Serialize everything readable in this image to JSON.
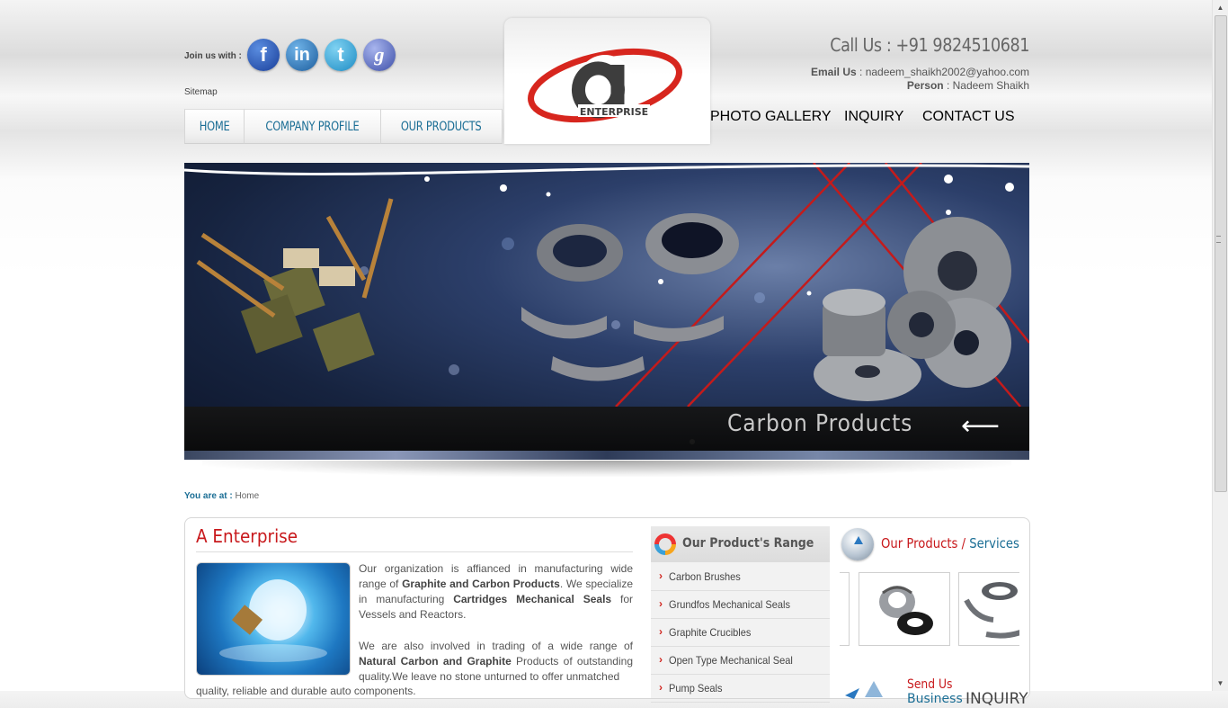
{
  "header": {
    "join_label": "Join us with :",
    "social": [
      {
        "name": "facebook",
        "glyph": "f"
      },
      {
        "name": "linkedin",
        "glyph": "in"
      },
      {
        "name": "twitter",
        "glyph": "t"
      },
      {
        "name": "google",
        "glyph": "g"
      }
    ],
    "sitemap": "Sitemap",
    "logo_text": "ENTERPRISE",
    "call_label": "Call Us : +91 9824510681",
    "email_label": "Email Us",
    "email_value": " : nadeem_shaikh2002@yahoo.com",
    "person_label": "Person",
    "person_value": " : Nadeem Shaikh"
  },
  "nav": {
    "left": [
      "HOME",
      "COMPANY PROFILE",
      "OUR PRODUCTS"
    ],
    "right": [
      "PHOTO GALLERY",
      "INQUIRY",
      "CONTACT US"
    ]
  },
  "banner": {
    "caption": "Carbon Products",
    "arrow": "⟵"
  },
  "breadcrumb": {
    "label": "You are at :",
    "current": "Home"
  },
  "about": {
    "title": "A Enterprise",
    "p1_a": "Our organization is affianced in manufacturing wide range of ",
    "p1_b": "Graphite and Carbon Products",
    "p1_c": ". We specialize in manufacturing ",
    "p1_d": "Cartridges Mechanical Seals",
    "p1_e": " for Vessels and Reactors.",
    "p2_a": "We are also involved in trading of a wide range of ",
    "p2_b": "Natural Carbon and Graphite",
    "p2_c": " Products of outstanding quality.We leave no stone unturned to offer unmatched",
    "p3": "quality, reliable and durable auto components."
  },
  "range": {
    "title": "Our Product's Range",
    "items": [
      "Carbon Brushes",
      "Grundfos Mechanical Seals",
      "Graphite Crucibles",
      "Open Type Mechanical Seal",
      "Pump Seals"
    ]
  },
  "products": {
    "title_red": "Our Products",
    "title_sep": " / ",
    "title_blue": "Services",
    "send_us": "Send Us",
    "send_us_2": "Business",
    "inquiry": "INQUIRY"
  },
  "colors": {
    "nav_text": "#1b6e95",
    "heading_red": "#c8191c",
    "link_blue": "#1b6e95"
  }
}
